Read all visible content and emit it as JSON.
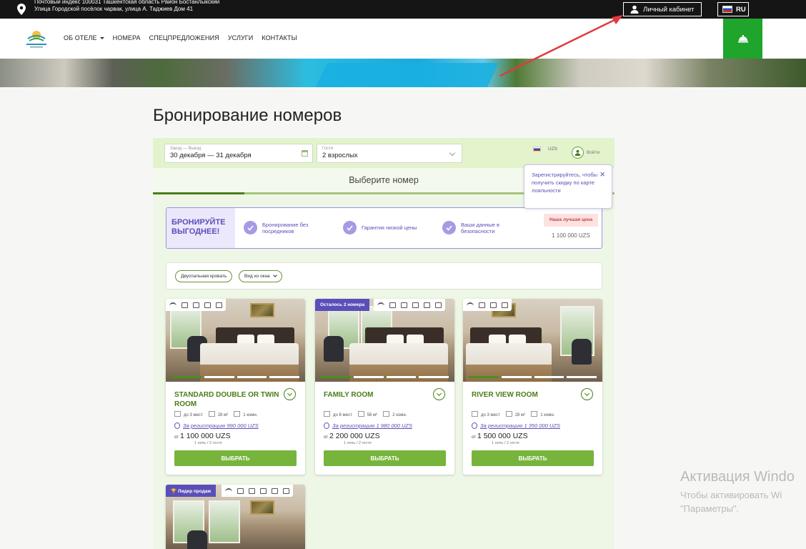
{
  "topbar": {
    "address": "Почтовый индекс 100031 Ташкентская область Район Бостанлыкский Улица Городской посёлок чарвак, улица А. Таджиев Дом 41",
    "cabinet_label": "Личный кабинет",
    "language": "RU"
  },
  "nav": {
    "items": [
      {
        "label": "ОБ ОТЕЛЕ"
      },
      {
        "label": "НОМЕРА"
      },
      {
        "label": "СПЕЦПРЕДЛОЖЕНИЯ"
      },
      {
        "label": "УСЛУГИ"
      },
      {
        "label": "КОНТАКТЫ"
      }
    ]
  },
  "page": {
    "title": "Бронирование номеров"
  },
  "search": {
    "date_label": "Заезд — Выезд",
    "date_value": "30 декабря — 31 декабря",
    "guests_label": "Гости",
    "guests_value": "2 взрослых",
    "currency": "UZS",
    "login_label": "Войти"
  },
  "tooltip": {
    "text": "Зарегистрируйтесь, чтобы получить скидку по карте лояльности"
  },
  "steps": {
    "current": "Выберите номер"
  },
  "promo": {
    "heading": "БРОНИРУЙТЕ ВЫГОДНЕЕ!",
    "features": [
      "Бронирование без посредников",
      "Гарантия низкой цены",
      "Ваши данные в безопасности"
    ],
    "best_label": "Наша лучшая цена",
    "best_price": "1 100 000 UZS"
  },
  "filters": [
    {
      "label": "Двуспальная кровать"
    },
    {
      "label": "Вид из окна"
    }
  ],
  "rooms": [
    {
      "name": "STANDARD DOUBLE OR TWIN ROOM",
      "badge": "",
      "capacity": "до 3 мест",
      "area": "28 м²",
      "rooms": "1 комн.",
      "reg_price": "За регистрацию 990 000 UZS",
      "from": "от",
      "price": "1 100 000 UZS",
      "price_note": "1 ночь / 2 гостя",
      "button": "ВЫБРАТЬ"
    },
    {
      "name": "FAMILY ROOM",
      "badge": "Осталось 2 номера",
      "capacity": "до 6 мест",
      "area": "56 м²",
      "rooms": "2 комн.",
      "reg_price": "За регистрацию 1 980 000 UZS",
      "from": "от",
      "price": "2 200 000 UZS",
      "price_note": "1 ночь / 2 гостя",
      "button": "ВЫБРАТЬ"
    },
    {
      "name": "RIVER VIEW ROOM",
      "badge": "",
      "capacity": "до 3 мест",
      "area": "28 м²",
      "rooms": "1 комн.",
      "reg_price": "За регистрацию 1 350 000 UZS",
      "from": "от",
      "price": "1 500 000 UZS",
      "price_note": "1 ночь / 2 гостя",
      "button": "ВЫБРАТЬ"
    },
    {
      "name": "",
      "badge": "Лидер продаж"
    }
  ],
  "watermark": {
    "line1": "Активация Windo",
    "line2": "Чтобы активировать Wi",
    "line3": "\"Параметры\"."
  },
  "colors": {
    "accent_green": "#77b43c",
    "title_green": "#4a7d17",
    "bell_green": "#1fa52b",
    "purple": "#5a4fb8",
    "annotation_red": "#e0393e"
  }
}
